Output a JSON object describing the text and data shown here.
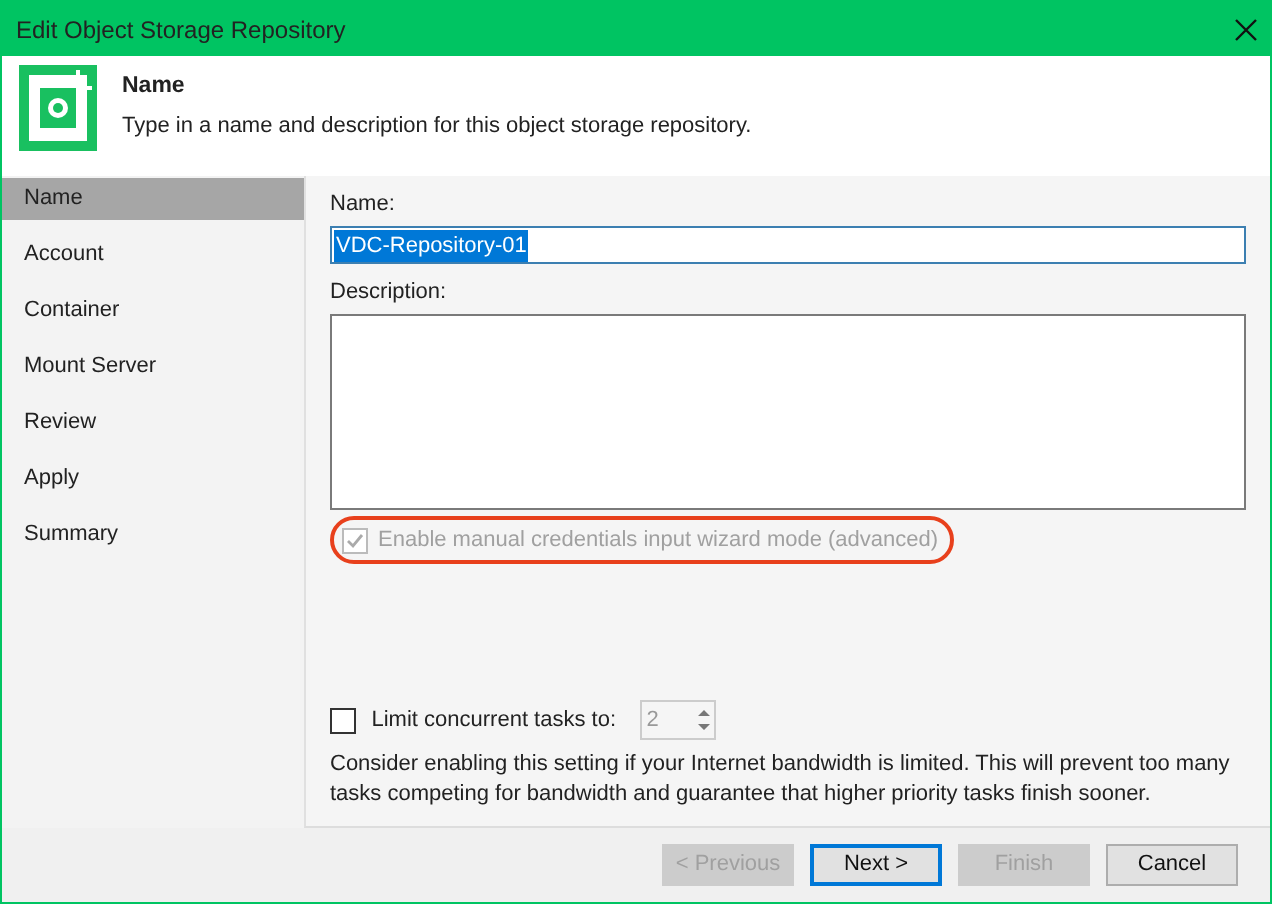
{
  "window": {
    "title": "Edit Object Storage Repository"
  },
  "header": {
    "title": "Name",
    "description": "Type in a name and description for this object storage repository."
  },
  "steps": [
    {
      "label": "Name",
      "selected": true
    },
    {
      "label": "Account",
      "selected": false
    },
    {
      "label": "Container",
      "selected": false
    },
    {
      "label": "Mount Server",
      "selected": false
    },
    {
      "label": "Review",
      "selected": false
    },
    {
      "label": "Apply",
      "selected": false
    },
    {
      "label": "Summary",
      "selected": false
    }
  ],
  "name_field": {
    "label": "Name:",
    "value": "VDC-Repository-01"
  },
  "description_field": {
    "label": "Description:"
  },
  "manual_credentials": {
    "label": "Enable manual credentials input wizard mode (advanced)",
    "checked": true,
    "disabled": true,
    "highlighted": true
  },
  "limit_tasks": {
    "label": "Limit concurrent tasks to:",
    "checked": false,
    "value": "2"
  },
  "hint": "Consider enabling this setting if your Internet bandwidth is limited. This will prevent too many tasks competing for bandwidth and guarantee that higher priority tasks finish sooner.",
  "buttons": [
    {
      "label": "< Previous",
      "disabled": true,
      "default": false
    },
    {
      "label": "Next >",
      "disabled": false,
      "default": true
    },
    {
      "label": "Finish",
      "disabled": true,
      "default": false
    },
    {
      "label": "Cancel",
      "disabled": false,
      "default": false
    }
  ]
}
